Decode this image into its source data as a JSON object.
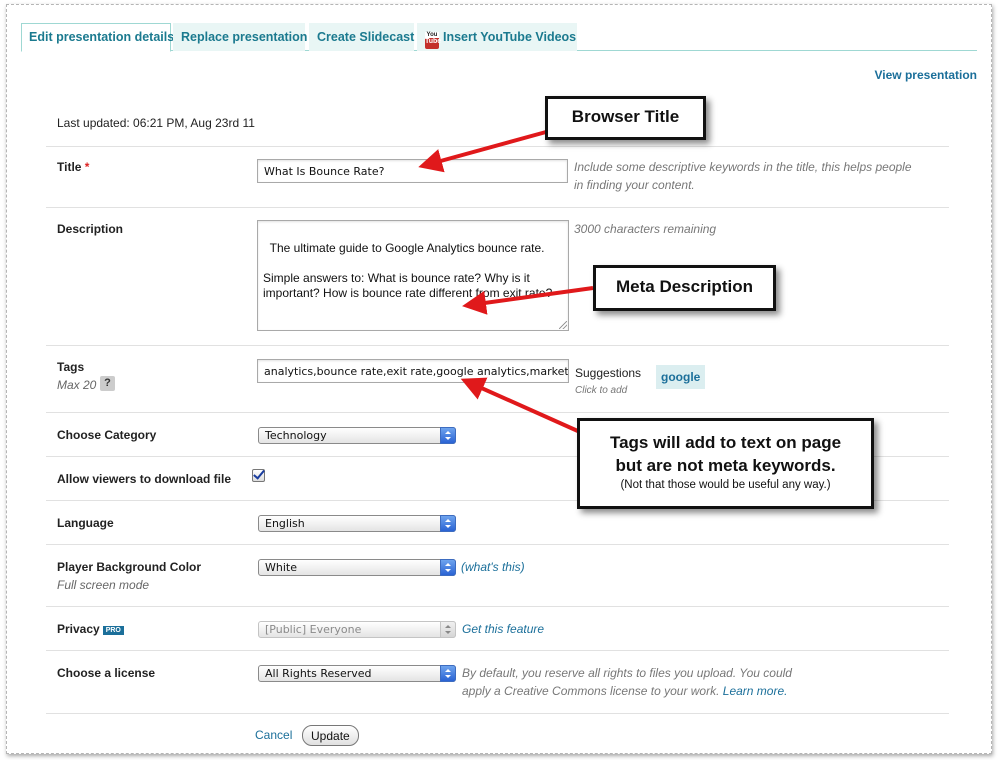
{
  "tabs": [
    {
      "label": "Edit presentation details",
      "active": true
    },
    {
      "label": "Replace presentation"
    },
    {
      "label": "Create Slidecast"
    },
    {
      "label": "Insert YouTube Videos",
      "icon": "youtube-icon"
    }
  ],
  "view_presentation": "View presentation",
  "last_updated": "Last updated: 06:21 PM, Aug 23rd 11",
  "form": {
    "title": {
      "label": "Title",
      "required_mark": "*",
      "value": "What Is Bounce Rate?",
      "hint_line1": "Include some descriptive keywords in the title, this helps people",
      "hint_line2": "in finding your content."
    },
    "description": {
      "label": "Description",
      "value": "The ultimate guide to Google Analytics bounce rate.\n\nSimple answers to: What is bounce rate? Why is it important? How is bounce rate different from exit rate?",
      "hint": "3000 characters remaining"
    },
    "tags": {
      "label": "Tags",
      "sublabel": "Max 20",
      "help": "?",
      "value": "analytics,bounce rate,exit rate,google analytics,marketing",
      "suggestions_label": "Suggestions",
      "suggestions_sub": "Click to add",
      "suggestion": "google"
    },
    "category": {
      "label": "Choose Category",
      "value": "Technology"
    },
    "download": {
      "label": "Allow viewers to download file",
      "checked": true
    },
    "language": {
      "label": "Language",
      "value": "English"
    },
    "player_bg": {
      "label": "Player Background Color",
      "sublabel": "Full screen mode",
      "value": "White",
      "link": "(what's this)"
    },
    "privacy": {
      "label": "Privacy",
      "badge": "PRO",
      "value": "[Public] Everyone",
      "link": "Get this feature"
    },
    "license": {
      "label": "Choose a license",
      "value": "All Rights Reserved",
      "hint_line1": "By default, you reserve all rights to files you upload. You could",
      "hint_line2": "apply a Creative Commons license to your work.",
      "hint_link": "Learn more."
    },
    "cancel": "Cancel",
    "update": "Update"
  },
  "annotations": {
    "browser_title": "Browser Title",
    "meta_description": "Meta Description",
    "tags_line1": "Tags will add to text on page",
    "tags_line2": "but are not meta keywords.",
    "tags_note": "(Not that those would be useful any way.)",
    "arrow_color": "#e0191b"
  }
}
